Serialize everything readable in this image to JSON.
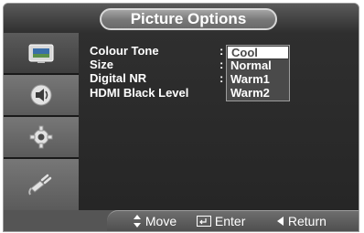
{
  "title": "Picture Options",
  "sidebar": {
    "items": [
      {
        "icon": "picture-icon",
        "state": "selected"
      },
      {
        "icon": "sound-icon",
        "state": "normal"
      },
      {
        "icon": "setup-gear-icon",
        "state": "normal"
      },
      {
        "icon": "input-plug-icon",
        "state": "normal"
      }
    ]
  },
  "menu": {
    "items": [
      {
        "label": "Colour Tone"
      },
      {
        "label": "Size"
      },
      {
        "label": "Digital NR"
      },
      {
        "label": "HDMI Black Level"
      }
    ],
    "colon": ":"
  },
  "dropdown": {
    "options": [
      "Cool",
      "Normal",
      "Warm1",
      "Warm2"
    ],
    "selected": "Cool"
  },
  "footer": {
    "move_icon": "up-down-arrow-icon",
    "move_label": "Move",
    "enter_icon": "enter-icon",
    "enter_label": "Enter",
    "return_icon": "left-triangle-icon",
    "return_label": "Return"
  },
  "colors": {
    "background": "#2e2e2e",
    "highlight": "#ffffff",
    "text": "#ffffff"
  }
}
